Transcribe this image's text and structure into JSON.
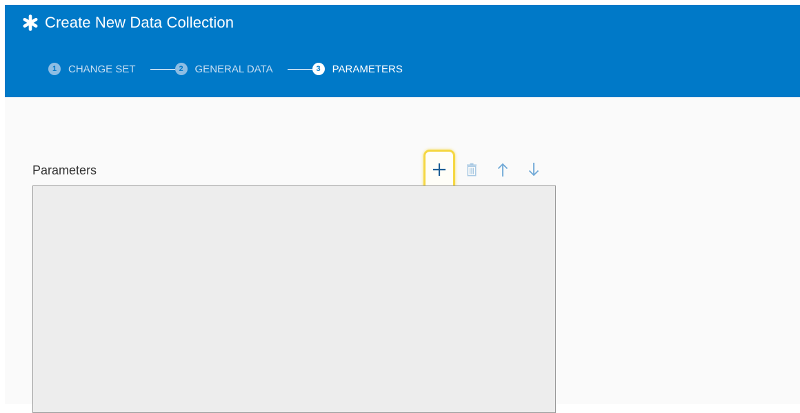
{
  "header": {
    "title": "Create New Data Collection",
    "icon": "asterisk-icon",
    "background_color": "#0079c8"
  },
  "wizard": {
    "steps": [
      {
        "number": "1",
        "label": "CHANGE SET",
        "active": false
      },
      {
        "number": "2",
        "label": "GENERAL DATA",
        "active": false
      },
      {
        "number": "3",
        "label": "PARAMETERS",
        "active": true
      }
    ]
  },
  "parameters": {
    "label": "Parameters",
    "toolbar": {
      "add": {
        "icon": "plus-icon",
        "highlight_color": "#f5d742"
      },
      "delete": {
        "icon": "trash-icon"
      },
      "move_up": {
        "icon": "arrow-up-icon"
      },
      "move_down": {
        "icon": "arrow-down-icon"
      }
    }
  }
}
